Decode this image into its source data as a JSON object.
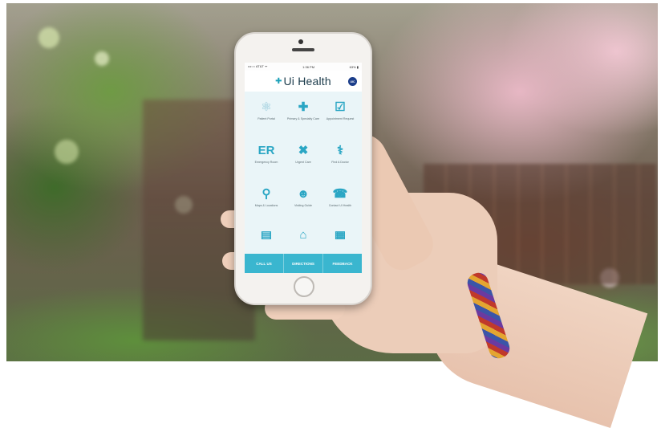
{
  "status_bar": {
    "carrier": "•••○○ AT&T ᯤ",
    "time": "1:36 PM",
    "battery": "63% ▮"
  },
  "app": {
    "logo_mark": "✚",
    "title": "Ui Health",
    "badge": "UIC"
  },
  "tiles": [
    {
      "icon": "atom-icon",
      "glyph": "⚛",
      "label": "Patient Portal",
      "pale": true
    },
    {
      "icon": "medical-bag-icon",
      "glyph": "✚",
      "label": "Primary & Specialty Care",
      "pale": false
    },
    {
      "icon": "calendar-check-icon",
      "glyph": "☑",
      "label": "Appointment Request",
      "pale": false
    },
    {
      "icon": "er-icon",
      "glyph": "ER",
      "label": "Emergency Room",
      "pale": false
    },
    {
      "icon": "bandage-icon",
      "glyph": "✖",
      "label": "Urgent Care",
      "pale": false
    },
    {
      "icon": "stethoscope-icon",
      "glyph": "⚕",
      "label": "Find A Doctor",
      "pale": false
    },
    {
      "icon": "map-pin-icon",
      "glyph": "⚲",
      "label": "Maps & Locations",
      "pale": false
    },
    {
      "icon": "person-icon",
      "glyph": "☻",
      "label": "Visiting Guide",
      "pale": false
    },
    {
      "icon": "phone-icon",
      "glyph": "☎",
      "label": "Contact UI Health",
      "pale": false
    },
    {
      "icon": "id-card-icon",
      "glyph": "▤",
      "label": "",
      "pale": false
    },
    {
      "icon": "building-icon",
      "glyph": "⌂",
      "label": "",
      "pale": false
    },
    {
      "icon": "calendar-icon",
      "glyph": "▦",
      "label": "",
      "pale": false
    }
  ],
  "tabbar": {
    "call": "CALL US",
    "directions": "DIRECTIONS",
    "feedback": "FEEDBACK"
  },
  "colors": {
    "accent": "#3ab6cf",
    "icon": "#2aa6c4",
    "title": "#1a3a4a"
  }
}
